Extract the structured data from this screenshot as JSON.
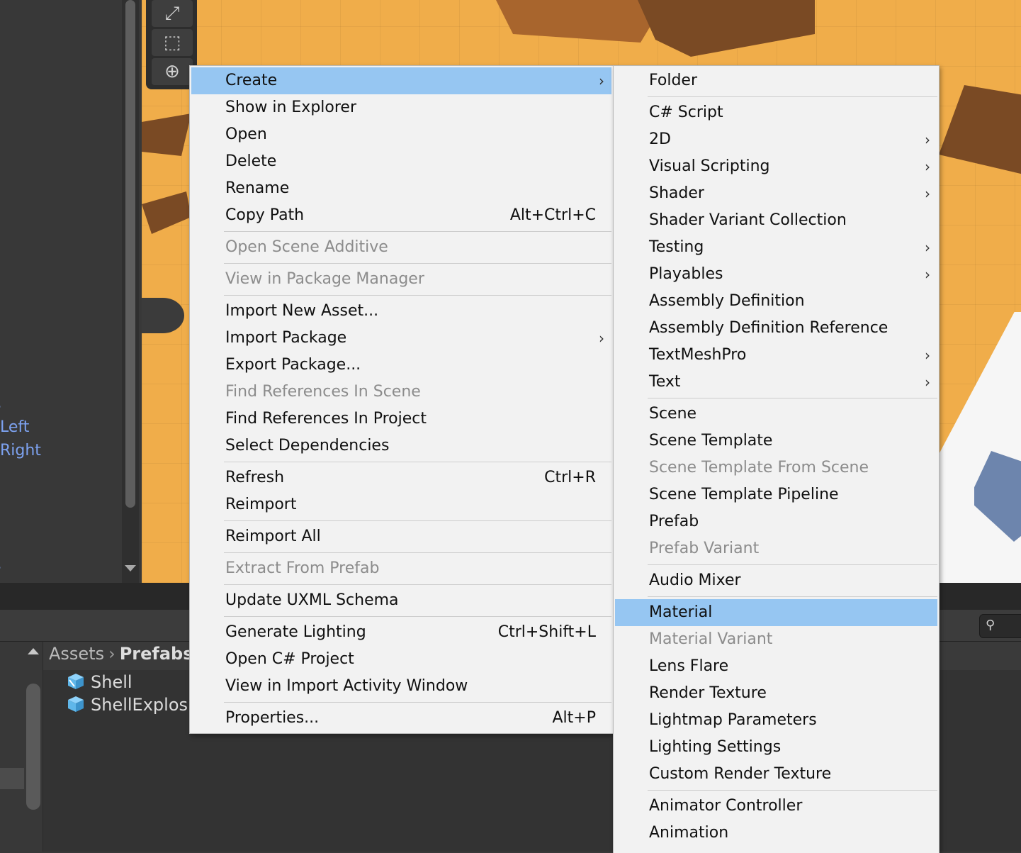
{
  "hierarchy": {
    "items": [
      {
        "label": "Left"
      },
      {
        "label": "Right"
      }
    ]
  },
  "project": {
    "breadcrumb": [
      "Assets",
      "Prefabs"
    ],
    "assets": [
      {
        "label": "Shell"
      },
      {
        "label": "ShellExplosi"
      }
    ]
  },
  "context_menu": {
    "items": [
      {
        "label": "Create",
        "submenu": true,
        "highlighted": true
      },
      {
        "label": "Show in Explorer"
      },
      {
        "label": "Open"
      },
      {
        "label": "Delete"
      },
      {
        "label": "Rename"
      },
      {
        "label": "Copy Path",
        "shortcut": "Alt+Ctrl+C"
      },
      {
        "label": "Open Scene Additive",
        "disabled": true
      },
      {
        "label": "View in Package Manager",
        "disabled": true
      },
      {
        "label": "Import New Asset..."
      },
      {
        "label": "Import Package",
        "submenu": true
      },
      {
        "label": "Export Package..."
      },
      {
        "label": "Find References In Scene",
        "disabled": true
      },
      {
        "label": "Find References In Project"
      },
      {
        "label": "Select Dependencies"
      },
      {
        "label": "Refresh",
        "shortcut": "Ctrl+R"
      },
      {
        "label": "Reimport"
      },
      {
        "label": "Reimport All"
      },
      {
        "label": "Extract From Prefab",
        "disabled": true
      },
      {
        "label": "Update UXML Schema"
      },
      {
        "label": "Generate Lighting",
        "shortcut": "Ctrl+Shift+L"
      },
      {
        "label": "Open C# Project"
      },
      {
        "label": "View in Import Activity Window"
      },
      {
        "label": "Properties...",
        "shortcut": "Alt+P"
      }
    ]
  },
  "create_submenu": {
    "items": [
      {
        "label": "Folder"
      },
      {
        "label": "C# Script"
      },
      {
        "label": "2D",
        "submenu": true
      },
      {
        "label": "Visual Scripting",
        "submenu": true
      },
      {
        "label": "Shader",
        "submenu": true
      },
      {
        "label": "Shader Variant Collection"
      },
      {
        "label": "Testing",
        "submenu": true
      },
      {
        "label": "Playables",
        "submenu": true
      },
      {
        "label": "Assembly Definition"
      },
      {
        "label": "Assembly Definition Reference"
      },
      {
        "label": "TextMeshPro",
        "submenu": true
      },
      {
        "label": "Text",
        "submenu": true
      },
      {
        "label": "Scene"
      },
      {
        "label": "Scene Template"
      },
      {
        "label": "Scene Template From Scene",
        "disabled": true
      },
      {
        "label": "Scene Template Pipeline"
      },
      {
        "label": "Prefab"
      },
      {
        "label": "Prefab Variant",
        "disabled": true
      },
      {
        "label": "Audio Mixer"
      },
      {
        "label": "Material",
        "highlighted": true
      },
      {
        "label": "Material Variant",
        "disabled": true
      },
      {
        "label": "Lens Flare"
      },
      {
        "label": "Render Texture"
      },
      {
        "label": "Lightmap Parameters"
      },
      {
        "label": "Lighting Settings"
      },
      {
        "label": "Custom Render Texture"
      },
      {
        "label": "Animator Controller"
      },
      {
        "label": "Animation"
      }
    ]
  },
  "icons": {
    "submenu_arrow": "chevron-right-icon",
    "breadcrumb_separator": "chevron-right-icon",
    "asset": "prefab-icon",
    "search": "search-icon"
  },
  "colors": {
    "highlight": "#96c6f2",
    "menu_bg": "#f2f2f2",
    "disabled_text": "#8c8c8c",
    "hierarchy_link": "#7da2f0",
    "scene_ground": "#f0ad4a",
    "prefab_blue": "#5fb7ea"
  }
}
